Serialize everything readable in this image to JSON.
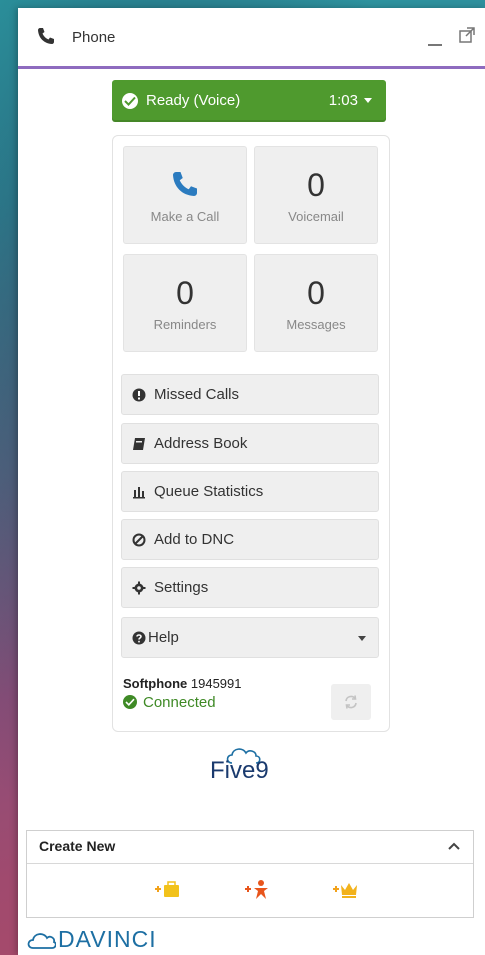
{
  "window": {
    "title": "Phone"
  },
  "status": {
    "label": "Ready (Voice)",
    "timer": "1:03"
  },
  "tiles": [
    {
      "count": "",
      "label": "Make a Call"
    },
    {
      "count": "0",
      "label": "Voicemail"
    },
    {
      "count": "0",
      "label": "Reminders"
    },
    {
      "count": "0",
      "label": "Messages"
    }
  ],
  "menu": [
    {
      "label": "Missed Calls",
      "icon": "exclamation-icon"
    },
    {
      "label": "Address Book",
      "icon": "book-icon"
    },
    {
      "label": "Queue Statistics",
      "icon": "bar-chart-icon"
    },
    {
      "label": "Add to DNC",
      "icon": "ban-icon"
    },
    {
      "label": "Settings",
      "icon": "gear-icon"
    },
    {
      "label": "Help",
      "icon": "question-icon"
    }
  ],
  "softphone": {
    "label": "Softphone",
    "number": "1945991",
    "status": "Connected"
  },
  "logo": {
    "text": "Five9"
  },
  "create_new": {
    "label": "Create New"
  },
  "footer": {
    "brand": "DAVINCI"
  },
  "colors": {
    "ready_green": "#4f9a2e",
    "accent_purple": "#8e6bbf",
    "brand_blue": "#1d6fa3"
  }
}
